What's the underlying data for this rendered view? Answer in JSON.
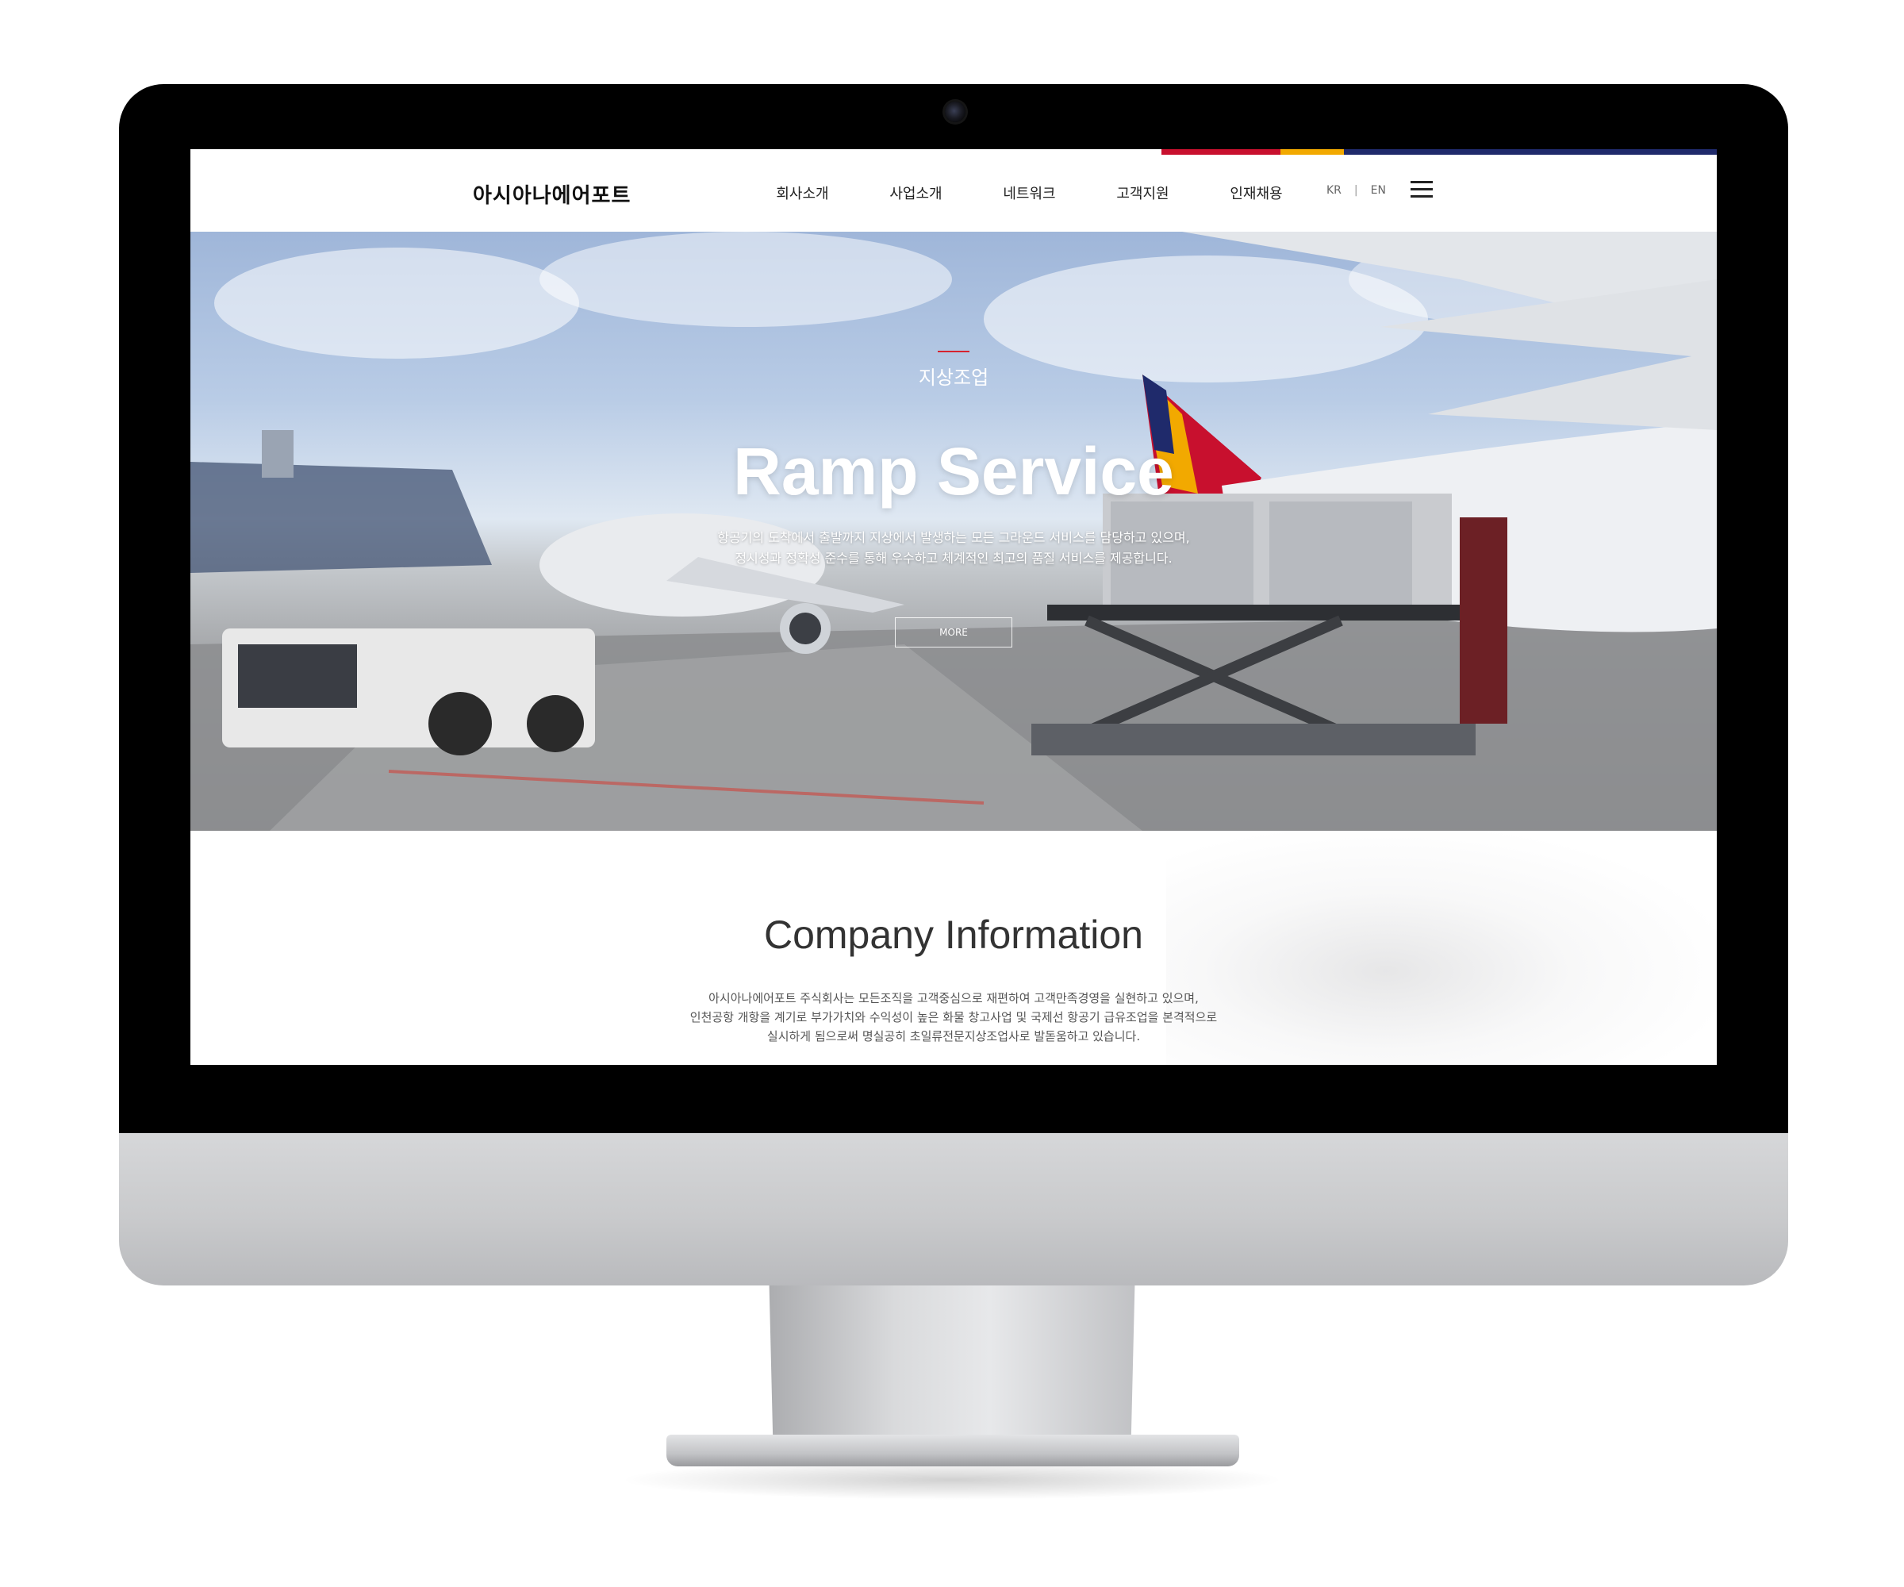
{
  "header": {
    "logo": "아시아나에어포트",
    "nav": [
      "회사소개",
      "사업소개",
      "네트워크",
      "고객지원",
      "인재채용"
    ],
    "lang": {
      "kr": "KR",
      "separator": "|",
      "en": "EN"
    },
    "menu_icon": "hamburger-menu-icon"
  },
  "hero": {
    "subtitle": "지상조업",
    "title": "Ramp Service",
    "desc_line1": "항공기의 도착에서 출발까지 지상에서 발생하는 모든 그라운드 서비스를 담당하고 있으며,",
    "desc_line2": "정시성과 정확성 준수를 통해 우수하고 체계적인 최고의 품질 서비스를 제공합니다.",
    "more": "MORE"
  },
  "company": {
    "title": "Company Information",
    "line1": "아시아나에어포트 주식회사는 모든조직을 고객중심으로 재편하여 고객만족경영을 실현하고 있으며,",
    "line2": "인천공항 개항을 계기로 부가가치와 수익성이 높은 화물 창고사업 및 국제선 항공기 급유조업을 본격적으로",
    "line3": "실시하게 됨으로써 명실공히 초일류전문지상조업사로 발돋움하고 있습니다."
  },
  "colors": {
    "accent_red": "#d6232f",
    "stripe": [
      "#c8102e",
      "#f2a900",
      "#1f2a6b"
    ]
  }
}
